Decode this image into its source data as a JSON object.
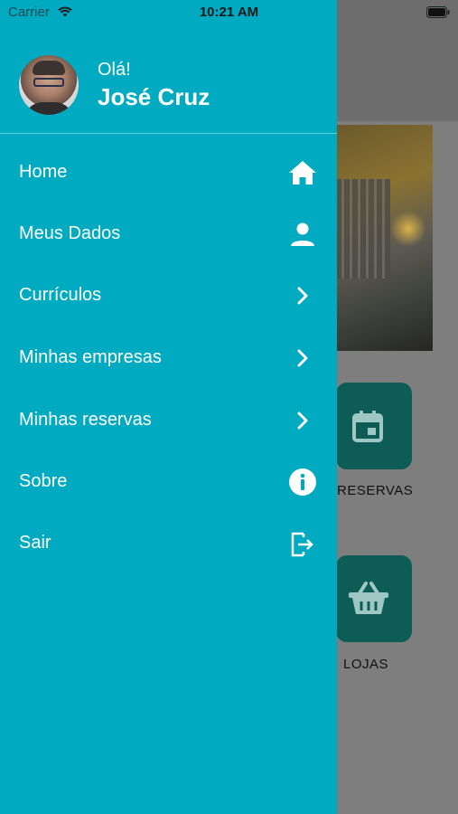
{
  "status_bar": {
    "carrier": "Carrier",
    "time": "10:21 AM"
  },
  "profile": {
    "greeting": "Olá!",
    "name": "José Cruz"
  },
  "menu": [
    {
      "label": "Home",
      "icon": "home-icon"
    },
    {
      "label": "Meus Dados",
      "icon": "person-icon"
    },
    {
      "label": "Currículos",
      "icon": "chevron-right-icon"
    },
    {
      "label": "Minhas empresas",
      "icon": "chevron-right-icon"
    },
    {
      "label": "Minhas reservas",
      "icon": "chevron-right-icon"
    },
    {
      "label": "Sobre",
      "icon": "info-icon"
    },
    {
      "label": "Sair",
      "icon": "logout-icon"
    }
  ],
  "background_screen": {
    "tiles": [
      {
        "label": "RESERVAS",
        "icon": "calendar-icon"
      },
      {
        "label": "LOJAS",
        "icon": "basket-icon"
      }
    ]
  },
  "colors": {
    "drawer": "#00aac0",
    "tile": "#0e5c56",
    "text": "#ffffff"
  }
}
